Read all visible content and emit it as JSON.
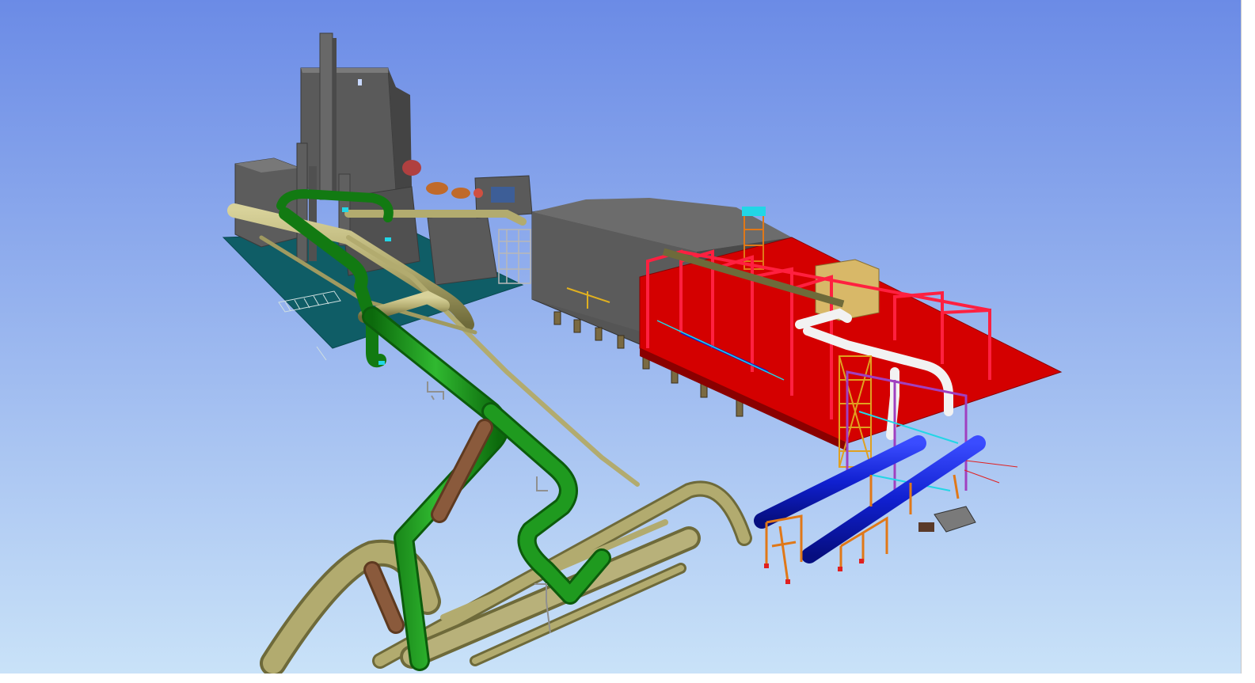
{
  "viewer": {
    "background_top": "#6b8be6",
    "background_bottom": "#c9e2f8"
  },
  "colors": {
    "building": "#585858",
    "building_light": "#6a6a6a",
    "building_dark": "#444444",
    "platform_red": "#d40000",
    "frame_red": "#e8102a",
    "pipe_green": "#1f9a1f",
    "pipe_olive": "#b2ab6f",
    "pipe_brown": "#8a5a3c",
    "pipe_blue": "#1020d0",
    "pipe_white": "#f0f0f0",
    "support_orange": "#e07818",
    "teal_slab": "#0f5d66",
    "cyan_detail": "#22d6e6",
    "tan_box": "#d8b868"
  },
  "scene_objects": [
    "stack-main",
    "stack-small",
    "boiler-house",
    "turbine-hall",
    "red-platform",
    "green-pipeline",
    "olive-pipeline",
    "blue-pipes",
    "white-pipe",
    "pipe-rack-frames"
  ]
}
